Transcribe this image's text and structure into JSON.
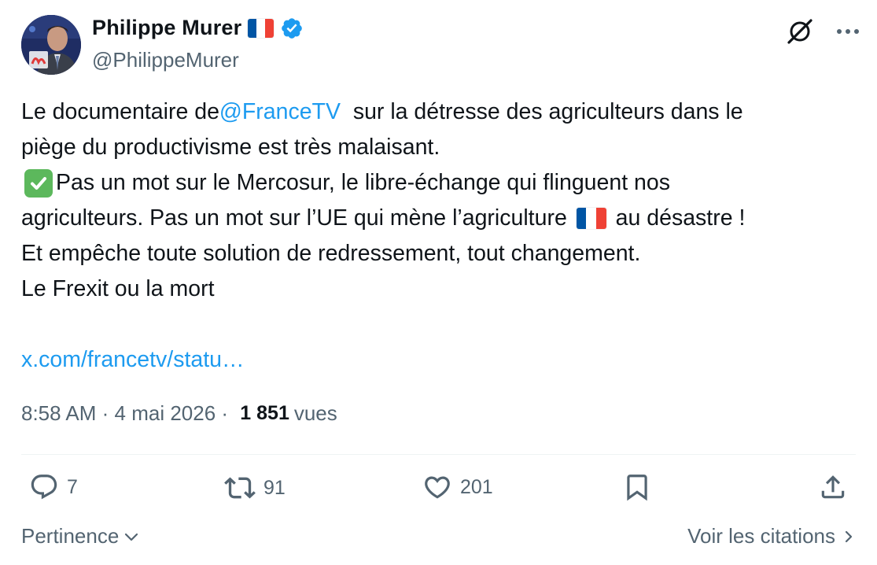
{
  "author": {
    "name": "Philippe Murer",
    "handle": "@PhilippeMurer",
    "verified": true,
    "flag": "France flag"
  },
  "tweet": {
    "line1_before": "Le documentaire de ",
    "mention": "@FranceTV",
    "line1_after": "  sur la détresse des agriculteurs dans le",
    "line2": "piège du productivisme est très malaisant.",
    "line3": "Pas un mot sur le Mercosur, le libre-échange qui flinguent nos",
    "line4_before": "agriculteurs. Pas un mot sur l’UE qui mène l’agriculture ",
    "line4_after": " au désastre !",
    "line5": "Et empêche toute solution de redressement, tout changement.",
    "line6": "Le Frexit ou la mort",
    "link": "x.com/francetv/statu…"
  },
  "meta": {
    "time": "8:58 AM",
    "separator1": " · ",
    "date": "4 mai 2026",
    "separator2": " · ",
    "views_count": "1 851",
    "views_label": "vues"
  },
  "actions": {
    "replies": "7",
    "reposts": "91",
    "likes": "201"
  },
  "footer": {
    "sort_label": "Pertinence",
    "quotes_label": "Voir les citations"
  },
  "colors": {
    "accent": "#1d9bf0",
    "text": "#0f1419",
    "secondary": "#536471",
    "divider": "#eff3f4"
  }
}
